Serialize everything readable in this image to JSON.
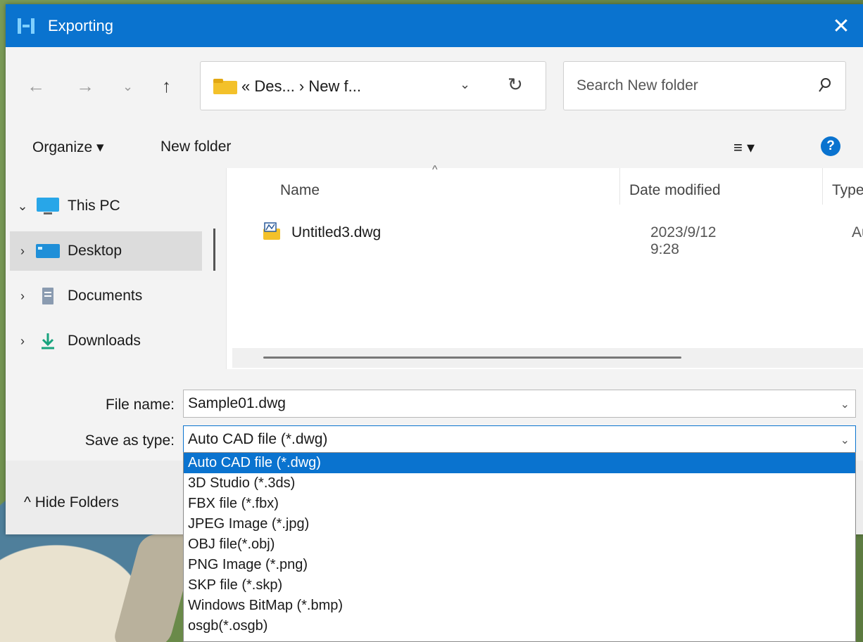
{
  "window": {
    "title": "Exporting",
    "close_glyph": "✕"
  },
  "nav": {
    "back": "←",
    "forward": "→",
    "recent": "⌄",
    "up": "↑",
    "breadcrumb": "« Des... › New f...",
    "address_dropdown": "⌄",
    "refresh": "↻",
    "search_placeholder": "Search New folder"
  },
  "toolbar": {
    "organize": "Organize ▾",
    "new_folder": "New folder",
    "view_menu": "≡ ▾",
    "help": "?"
  },
  "sidebar": {
    "items": [
      {
        "label": "This PC",
        "chevron": "⌄",
        "icon": "monitor-icon"
      },
      {
        "label": "Desktop",
        "chevron": "›",
        "icon": "desktop-icon"
      },
      {
        "label": "Documents",
        "chevron": "›",
        "icon": "document-icon"
      },
      {
        "label": "Downloads",
        "chevron": "›",
        "icon": "download-icon"
      }
    ]
  },
  "files": {
    "columns": {
      "name": "Name",
      "date": "Date modified",
      "type": "Type"
    },
    "sort_indicator": "^",
    "rows": [
      {
        "name": "Untitled3.dwg",
        "date": "2023/9/12 9:28",
        "type": "Auto"
      }
    ]
  },
  "form": {
    "file_name_label": "File name:",
    "file_name_value": "Sample01.dwg",
    "save_type_label": "Save as type:",
    "save_type_value": "Auto CAD file (*.dwg)",
    "dropdown_glyph": "⌄",
    "hide_folders": "^  Hide Folders"
  },
  "save_type_options": [
    "Auto CAD file (*.dwg)",
    "3D Studio (*.3ds)",
    "FBX file (*.fbx)",
    "JPEG Image (*.jpg)",
    "OBJ file(*.obj)",
    "PNG Image (*.png)",
    "SKP file (*.skp)",
    "Windows BitMap (*.bmp)",
    "osgb(*.osgb)"
  ],
  "colors": {
    "accent": "#0a73cf",
    "titlebar": "#0a73cf"
  }
}
